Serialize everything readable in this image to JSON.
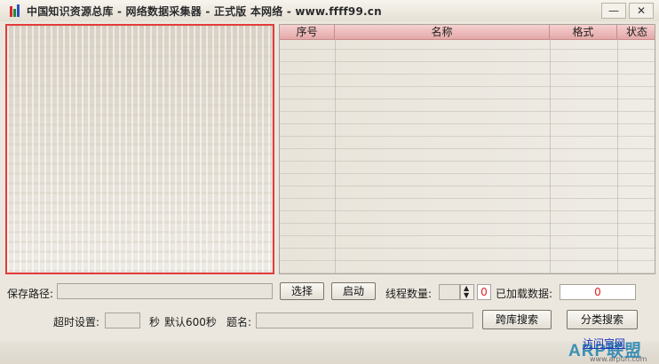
{
  "window": {
    "title": "中国知识资源总库 - 网络数据采集器 - 正式版 本网络 - www.ffff99.cn",
    "minimize_glyph": "—",
    "close_glyph": "✕"
  },
  "list": {
    "columns": [
      "序号",
      "名称",
      "格式",
      "状态"
    ]
  },
  "controls": {
    "save_path_label": "保存路径:",
    "save_path_value": "",
    "select_button": "选择",
    "start_button": "启动",
    "thread_count_label": "线程数量:",
    "thread_count_value": "",
    "thread_spin_value": "0",
    "loaded_label": "已加载数据:",
    "loaded_value": "0",
    "timeout_label": "超时设置:",
    "timeout_value": "",
    "timeout_unit": "秒",
    "timeout_default": "默认600秒",
    "title_label": "题名:",
    "title_value": "",
    "cross_db_search_button": "跨库搜索",
    "category_search_button": "分类搜索",
    "official_site_link": "访问官网"
  },
  "watermark": {
    "logo_text": "ARP联盟",
    "url_text": "www.arpun.com"
  },
  "colors": {
    "header_row": "#e4a8a8",
    "preview_border": "#e33b3b",
    "value_red": "#dd2222",
    "link_blue": "#1a35b8",
    "watermark_blue": "#3d8fb5"
  }
}
